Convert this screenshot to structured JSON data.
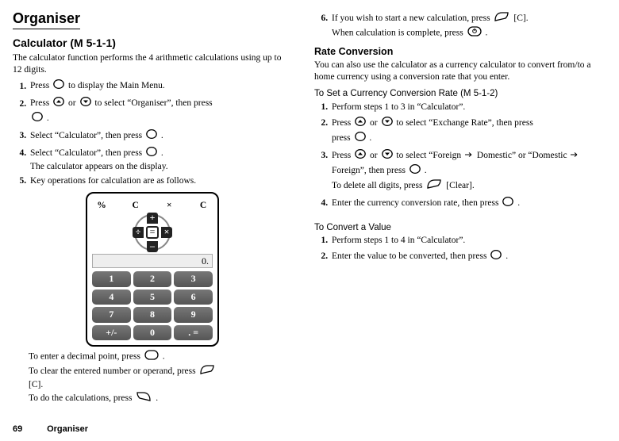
{
  "page": {
    "num": "69",
    "section": "Organiser"
  },
  "left": {
    "h1": "Organiser",
    "h2_label": "Calculator",
    "h2_code": "(M 5-1-1)",
    "intro": "The calculator function performs the 4 arithmetic calculations using up to 12 digits.",
    "steps": {
      "s1a": "Press ",
      "s1b": " to display the Main Menu.",
      "s2a": "Press ",
      "s2b": " or ",
      "s2c": " to select “Organiser”, then press ",
      "s2d": ".",
      "s3a": "Select “Calculator”, then press ",
      "s3b": ".",
      "s4a": "Select “Calculator”, then press ",
      "s4b": ".",
      "s4c": "The calculator appears on the display.",
      "s5": "Key operations for calculation are as follows."
    },
    "sub": {
      "l1a": "To enter a decimal point, press ",
      "l1b": ".",
      "l2a": "To clear the entered number or operand, press ",
      "l2b": " [C].",
      "l3a": "To do the calculations, press ",
      "l3b": "."
    },
    "calc": {
      "top": [
        "%",
        "C",
        "×",
        "C"
      ],
      "cross": {
        "up": "+",
        "down": "–",
        "left": "÷",
        "right": "×",
        "center": "="
      },
      "display": "0.",
      "keys": [
        "1",
        "2",
        "3",
        "4",
        "5",
        "6",
        "7",
        "8",
        "9",
        "+/-",
        "0",
        ". ="
      ]
    }
  },
  "right": {
    "cont": {
      "s6a": "If you wish to start a new calculation, press ",
      "s6b": " [C].",
      "s6c": "When calculation is complete, press ",
      "s6d": "."
    },
    "h3": "Rate Conversion",
    "p": "You can also use the calculator as a currency calculator to convert from/to a home currency using a conversion rate that you enter.",
    "h4a_label": "To Set a Currency Conversion Rate",
    "h4a_code": "(M 5-1-2)",
    "setRate": {
      "s1": "Perform steps 1 to 3 in “Calculator”.",
      "s2a": "Press ",
      "s2b": " or ",
      "s2c": " to select “Exchange Rate”, then press ",
      "s2d": ".",
      "s3a": "Press ",
      "s3b": " or ",
      "s3c": " to select “Foreign ",
      "s3d": " Domestic” or “Domestic ",
      "s3e": " Foreign”, then press ",
      "s3f": ".",
      "s3g": "To delete all digits, press ",
      "s3h": " [Clear].",
      "s4a": "Enter the currency conversion rate, then press ",
      "s4b": "."
    },
    "h4b": "To Convert a Value",
    "convert": {
      "s1": "Perform steps 1 to 4 in “Calculator”.",
      "s2a": "Enter the value to be converted, then press ",
      "s2b": "."
    }
  }
}
